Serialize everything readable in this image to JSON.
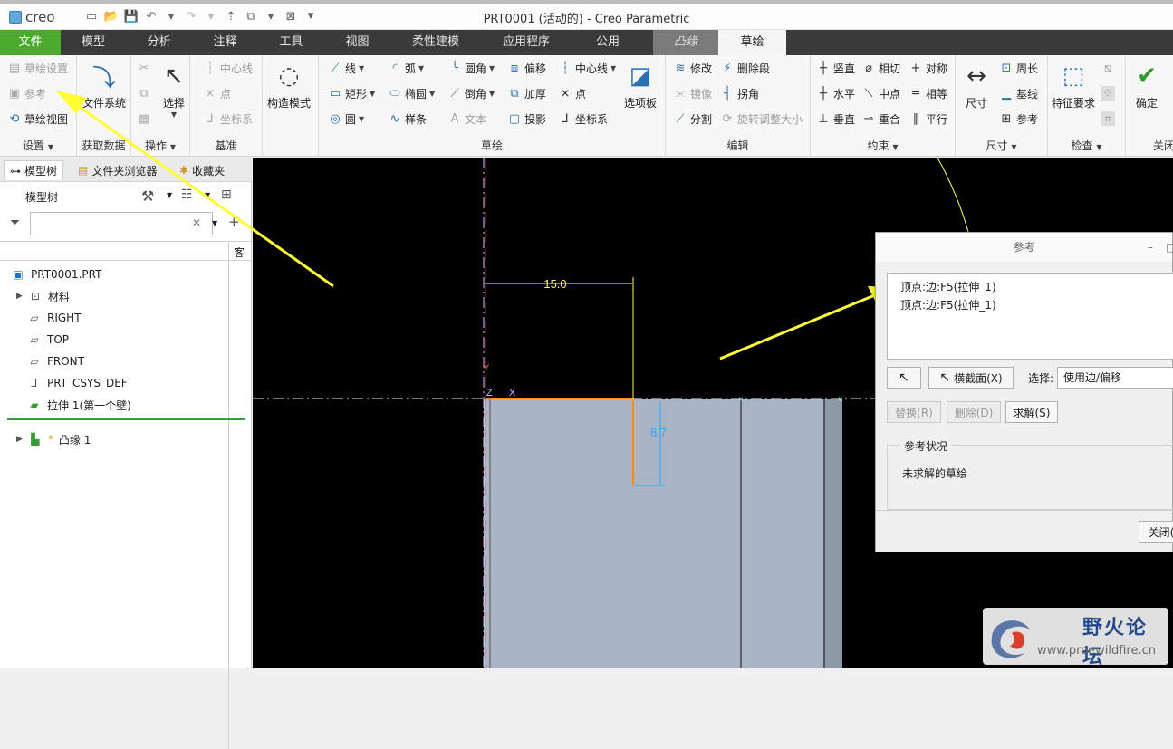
{
  "app": {
    "logo": "creo",
    "window_title": "PRT0001 (活动的) - Creo Parametric"
  },
  "tabs": [
    "文件",
    "模型",
    "分析",
    "注释",
    "工具",
    "视图",
    "柔性建模",
    "应用程序",
    "公用",
    "凸缘",
    "草绘"
  ],
  "ribbon": {
    "setup": {
      "label": "设置",
      "items": [
        "草绘设置",
        "参考",
        "草绘视图"
      ]
    },
    "get_data": {
      "label": "获取数据",
      "big": "文件系统"
    },
    "operations": {
      "label": "操作",
      "big": "选择"
    },
    "datum": {
      "label": "基准",
      "items": [
        "中心线",
        "点",
        "坐标系"
      ]
    },
    "construction": {
      "big": "构造模式"
    },
    "sketch": {
      "label": "草绘",
      "col1": [
        "线",
        "矩形",
        "圆"
      ],
      "col2": [
        "弧",
        "椭圆",
        "样条"
      ],
      "col3": [
        "圆角",
        "倒角",
        "文本"
      ],
      "col4": [
        "偏移",
        "加厚",
        "投影"
      ],
      "col5": [
        "中心线",
        "点",
        "坐标系"
      ],
      "big": "选项板"
    },
    "edit": {
      "label": "编辑",
      "items": [
        "修改",
        "删除段",
        "镜像",
        "拐角",
        "分割",
        "旋转调整大小"
      ]
    },
    "constrain": {
      "label": "约束",
      "items": [
        "竖直",
        "相切",
        "对称",
        "水平",
        "中点",
        "相等",
        "垂直",
        "重合",
        "平行"
      ]
    },
    "dimension": {
      "label": "尺寸",
      "big": "尺寸",
      "items": [
        "周长",
        "基线",
        "参考"
      ]
    },
    "inspect": {
      "label": "检查",
      "big": "特征要求"
    },
    "close": {
      "label": "关闭",
      "big": "确定"
    }
  },
  "left_panel": {
    "tabs": [
      "模型树",
      "文件夹浏览器",
      "收藏夹"
    ],
    "tree_title": "模型树",
    "col_header": "客",
    "filter_placeholder": "",
    "tree": [
      {
        "label": "PRT0001.PRT",
        "icon": "part-icon",
        "expand": ""
      },
      {
        "label": "材料",
        "icon": "material-icon",
        "expand": "▶"
      },
      {
        "label": "RIGHT",
        "icon": "datum-plane-icon",
        "expand": ""
      },
      {
        "label": "TOP",
        "icon": "datum-plane-icon",
        "expand": ""
      },
      {
        "label": "FRONT",
        "icon": "datum-plane-icon",
        "expand": ""
      },
      {
        "label": "PRT_CSYS_DEF",
        "icon": "csys-icon",
        "expand": ""
      },
      {
        "label": "拉伸 1(第一个壁)",
        "icon": "extrude-icon",
        "expand": ""
      },
      {
        "label": "凸缘 1",
        "icon": "flange-icon",
        "expand": "▶",
        "prefix": "*"
      }
    ]
  },
  "canvas": {
    "dim_horizontal": "15.0",
    "dim_vertical": "8.7",
    "axis_y": "Y",
    "axis_z": "Z",
    "axis_x": "X"
  },
  "dialog": {
    "title": "参考",
    "refs": [
      "顶点:边:F5(拉伸_1)",
      "顶点:边:F5(拉伸_1)"
    ],
    "cross_section_button": "横截面(X)",
    "select_label": "选择:",
    "select_value": "使用边/偏移",
    "replace_button": "替换(R)",
    "delete_button": "删除(D)",
    "solve_button": "求解(S)",
    "status_legend": "参考状况",
    "status_text": "未求解的草绘",
    "close_button": "关闭("
  },
  "watermark": {
    "title": "野火论坛",
    "url": "www.proewildfire.cn"
  },
  "colors": {
    "file_tab": "#4caa2e",
    "tab_bar": "#3a3a3a",
    "canvas_bg": "#000000",
    "part_fill": "#a9b4c4",
    "dimension": "#ffff55",
    "sketch_orange": "#ff8c1a",
    "annotation_arrow": "#ffff33",
    "accent_blue": "#2c6fb0"
  }
}
